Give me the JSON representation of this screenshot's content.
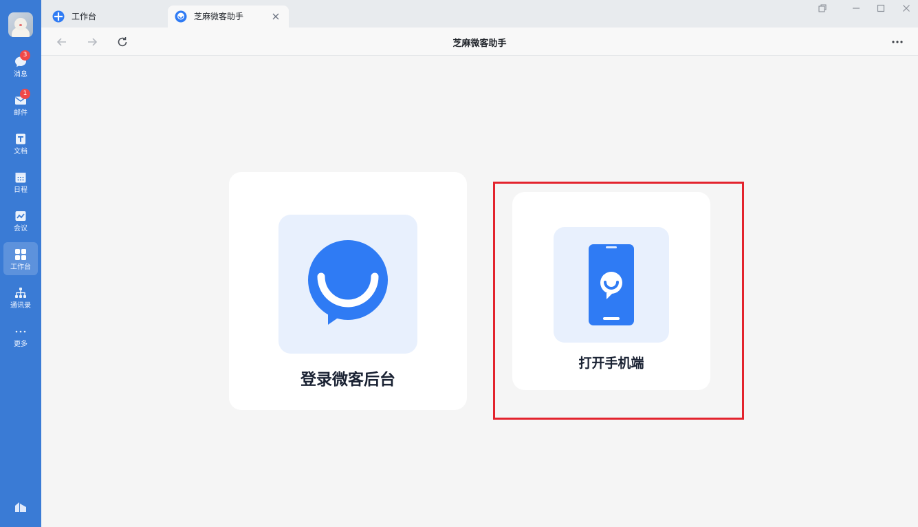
{
  "sidebar": {
    "items": [
      {
        "label": "消息",
        "icon": "chat-bubble-icon",
        "badge": "3"
      },
      {
        "label": "邮件",
        "icon": "mail-icon",
        "badge": "1"
      },
      {
        "label": "文档",
        "icon": "document-icon"
      },
      {
        "label": "日程",
        "icon": "calendar-icon"
      },
      {
        "label": "会议",
        "icon": "meeting-icon"
      },
      {
        "label": "工作台",
        "icon": "workbench-grid-icon",
        "active": true
      },
      {
        "label": "通讯录",
        "icon": "org-chart-icon"
      },
      {
        "label": "更多",
        "icon": "more-dots-icon"
      }
    ]
  },
  "tabs": [
    {
      "label": "工作台",
      "icon": "workbench-icon"
    },
    {
      "label": "芝麻微客助手",
      "icon": "weike-assistant-icon",
      "active": true
    }
  ],
  "toolbar": {
    "title": "芝麻微客助手"
  },
  "main": {
    "cards": [
      {
        "label": "登录微客后台",
        "icon": "chat-smile-bubble-icon"
      },
      {
        "label": "打开手机端",
        "icon": "mobile-phone-icon",
        "highlighted": true
      }
    ]
  },
  "colors": {
    "sidebar_bg": "#3a7bd5",
    "accent": "#2f7bf4",
    "badge": "#f04848",
    "highlight_border": "#e3232d"
  }
}
